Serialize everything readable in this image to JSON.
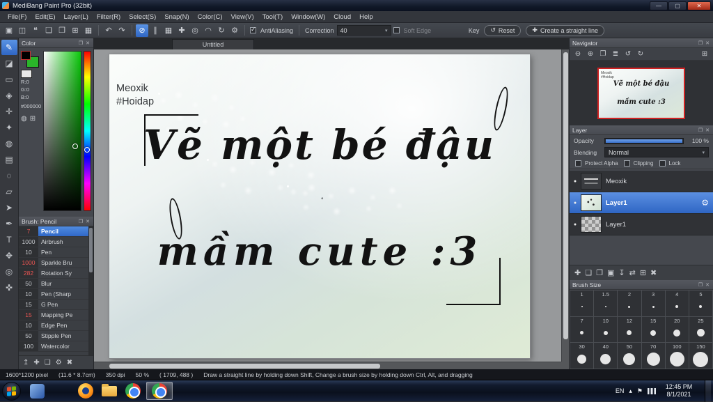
{
  "titlebar": {
    "title": "MediBang Paint Pro (32bit)",
    "minimize_icon": "—",
    "maximize_icon": "▢",
    "close_icon": "✕"
  },
  "menu": {
    "items": [
      "File(F)",
      "Edit(E)",
      "Layer(L)",
      "Filter(R)",
      "Select(S)",
      "Snap(N)",
      "Color(C)",
      "View(V)",
      "Tool(T)",
      "Window(W)",
      "Cloud",
      "Help"
    ]
  },
  "toolbar": {
    "file_icons": [
      "▣",
      "◫",
      "❝",
      "❏",
      "❐",
      "⊞",
      "▦"
    ],
    "undo_icon": "↶",
    "redo_icon": "↷",
    "snap_icons": [
      "⊘",
      "∥",
      "▦",
      "✚",
      "◎",
      "◠",
      "↻",
      "⚙"
    ],
    "antialiasing_label": "AntiAliasing",
    "correction_label": "Correction",
    "correction_value": "40",
    "soft_edge_label": "Soft Edge",
    "key_label": "Key",
    "reset_icon": "↺",
    "reset_label": "Reset",
    "line_icon": "✚",
    "line_label": "Create a straight line"
  },
  "panel_icons": {
    "dock": "❐",
    "close": "✕"
  },
  "tool_glyphs": [
    "✎",
    "◪",
    "▭",
    "◈",
    "✛",
    "✦",
    "◍",
    "▤",
    "◌",
    "▱",
    "➤",
    "✒",
    "T",
    "✥",
    "◎",
    "✜"
  ],
  "color_panel": {
    "title": "Color",
    "r": "R:0",
    "g": "G:0",
    "b": "B:0",
    "hex": "#000000",
    "front_swatch_color": "#000000",
    "back_swatch_color": "#2ab52a",
    "wheel_icon": "◍",
    "grid_icon": "⊞"
  },
  "brush_panel": {
    "title": "Brush: Pencil",
    "brushes": [
      {
        "size": "7",
        "name": "Pencil",
        "hot": true,
        "selected": true
      },
      {
        "size": "1000",
        "name": "Airbrush"
      },
      {
        "size": "10",
        "name": "Pen"
      },
      {
        "size": "1000",
        "name": "Sparkle Bru",
        "hot": true
      },
      {
        "size": "282",
        "name": "Rotation Sy",
        "hot": true
      },
      {
        "size": "50",
        "name": "Blur"
      },
      {
        "size": "10",
        "name": "Pen (Sharp"
      },
      {
        "size": "15",
        "name": "G Pen"
      },
      {
        "size": "15",
        "name": "Mapping Pe",
        "hot": true
      },
      {
        "size": "10",
        "name": "Edge Pen"
      },
      {
        "size": "50",
        "name": "Stipple Pen"
      },
      {
        "size": "100",
        "name": "Watercolor"
      }
    ],
    "footer_icons": [
      "↥",
      "✚",
      "❏",
      "⚙",
      "✖"
    ]
  },
  "canvas": {
    "tab": "Untitled",
    "signature": [
      "Meoxik",
      "#Hoidap"
    ],
    "art": [
      "Vẽ một bé đậu",
      "mầm cute :3"
    ],
    "cursor_mark": "°"
  },
  "navigator": {
    "title": "Navigator",
    "zoom_icons": [
      "⊖",
      "⊕",
      "❐",
      "≣",
      "↺",
      "↻"
    ],
    "reset_icon": "⊞"
  },
  "layer_panel": {
    "title": "Layer",
    "opacity_label": "Opacity",
    "opacity_value": "100 %",
    "blending_label": "Blending",
    "blending_value": "Normal",
    "checkbox_labels": [
      "Protect Alpha",
      "Clipping",
      "Lock"
    ],
    "visibility_icon": "●",
    "gear_icon": "⚙",
    "layers": [
      {
        "name": "Meoxik",
        "visible": true
      },
      {
        "name": "Layer1",
        "visible": true,
        "selected": true
      },
      {
        "name": "Layer1",
        "visible": true
      }
    ],
    "footer_icons": [
      "✚",
      "❏",
      "❐",
      "▣",
      "↧",
      "⇄",
      "⊞",
      "✖"
    ]
  },
  "brush_size_panel": {
    "title": "Brush Size",
    "sizes": [
      "1",
      "1.5",
      "2",
      "3",
      "4",
      "5",
      "7",
      "10",
      "12",
      "15",
      "20",
      "25",
      "30",
      "40",
      "50",
      "70",
      "100",
      "150"
    ]
  },
  "statusbar": {
    "dimensions": "1600*1200 pixel",
    "physical": "(11.6 * 8.7cm)",
    "dpi": "350 dpi",
    "zoom": "50 %",
    "coords": "( 1709, 488 )",
    "hint": "Draw a straight line by holding down Shift, Change a brush size by holding down Ctrl, Alt, and dragging"
  },
  "taskbar": {
    "language": "EN",
    "tray_arrow": "▴",
    "flag_icon": "⚑",
    "time": "12:45 PM",
    "date": "8/1/2021"
  }
}
